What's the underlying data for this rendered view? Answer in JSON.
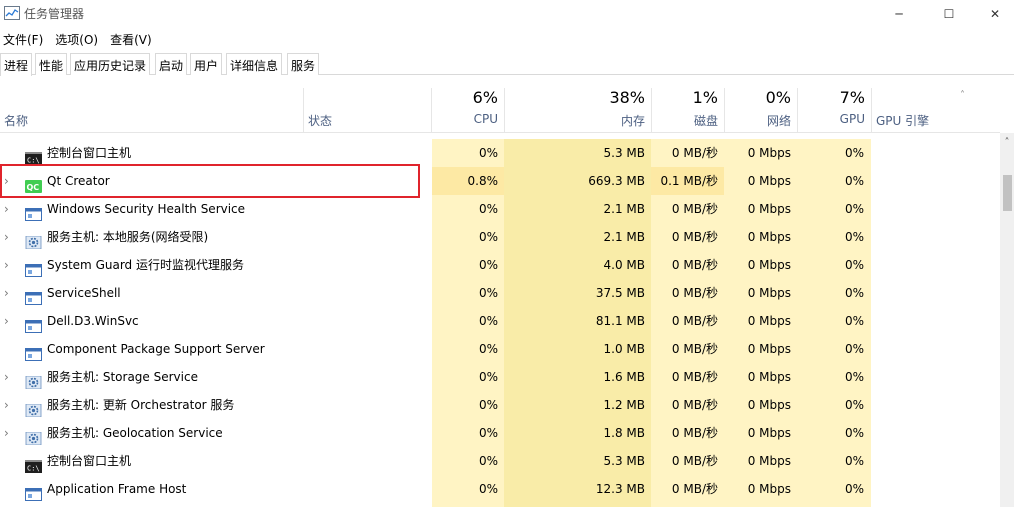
{
  "window": {
    "title": "任务管理器",
    "controls": {
      "minimize": "─",
      "maximize": "☐",
      "close": "✕"
    }
  },
  "menu": [
    "文件(F)",
    "选项(O)",
    "查看(V)"
  ],
  "tabs": [
    "进程",
    "性能",
    "应用历史记录",
    "启动",
    "用户",
    "详细信息",
    "服务"
  ],
  "active_tab": "进程",
  "columns": {
    "name": "名称",
    "status": "状态",
    "cpu": {
      "pct": "6%",
      "label": "CPU"
    },
    "memory": {
      "pct": "38%",
      "label": "内存"
    },
    "disk": {
      "pct": "1%",
      "label": "磁盘"
    },
    "network": {
      "pct": "0%",
      "label": "网络"
    },
    "gpu": {
      "pct": "7%",
      "label": "GPU"
    },
    "gpu_engine": "GPU 引擎"
  },
  "expander_glyph": "›",
  "sort_glyph": "˄",
  "scroll_up_glyph": "˄",
  "processes": [
    {
      "name": "控制台窗口主机",
      "icon": "console-icon",
      "expandable": false,
      "cpu": "0%",
      "memory": "5.3 MB",
      "disk": "0 MB/秒",
      "network": "0 Mbps",
      "gpu": "0%"
    },
    {
      "name": "Qt Creator",
      "icon": "qt-icon",
      "expandable": true,
      "cpu": "0.8%",
      "memory": "669.3 MB",
      "disk": "0.1 MB/秒",
      "network": "0 Mbps",
      "gpu": "0%",
      "highlight": true
    },
    {
      "name": "Windows Security Health Service",
      "icon": "window-icon",
      "expandable": true,
      "cpu": "0%",
      "memory": "2.1 MB",
      "disk": "0 MB/秒",
      "network": "0 Mbps",
      "gpu": "0%"
    },
    {
      "name": "服务主机: 本地服务(网络受限)",
      "icon": "gear-icon",
      "expandable": true,
      "cpu": "0%",
      "memory": "2.1 MB",
      "disk": "0 MB/秒",
      "network": "0 Mbps",
      "gpu": "0%"
    },
    {
      "name": "System Guard 运行时监视代理服务",
      "icon": "window-icon",
      "expandable": true,
      "cpu": "0%",
      "memory": "4.0 MB",
      "disk": "0 MB/秒",
      "network": "0 Mbps",
      "gpu": "0%"
    },
    {
      "name": "ServiceShell",
      "icon": "window-icon",
      "expandable": true,
      "cpu": "0%",
      "memory": "37.5 MB",
      "disk": "0 MB/秒",
      "network": "0 Mbps",
      "gpu": "0%"
    },
    {
      "name": "Dell.D3.WinSvc",
      "icon": "window-icon",
      "expandable": true,
      "cpu": "0%",
      "memory": "81.1 MB",
      "disk": "0 MB/秒",
      "network": "0 Mbps",
      "gpu": "0%"
    },
    {
      "name": "Component Package Support Server",
      "icon": "window-icon",
      "expandable": false,
      "cpu": "0%",
      "memory": "1.0 MB",
      "disk": "0 MB/秒",
      "network": "0 Mbps",
      "gpu": "0%"
    },
    {
      "name": "服务主机: Storage Service",
      "icon": "gear-icon",
      "expandable": true,
      "cpu": "0%",
      "memory": "1.6 MB",
      "disk": "0 MB/秒",
      "network": "0 Mbps",
      "gpu": "0%"
    },
    {
      "name": "服务主机: 更新 Orchestrator 服务",
      "icon": "gear-icon",
      "expandable": true,
      "cpu": "0%",
      "memory": "1.2 MB",
      "disk": "0 MB/秒",
      "network": "0 Mbps",
      "gpu": "0%"
    },
    {
      "name": "服务主机: Geolocation Service",
      "icon": "gear-icon",
      "expandable": true,
      "cpu": "0%",
      "memory": "1.8 MB",
      "disk": "0 MB/秒",
      "network": "0 Mbps",
      "gpu": "0%"
    },
    {
      "name": "控制台窗口主机",
      "icon": "console-icon",
      "expandable": false,
      "cpu": "0%",
      "memory": "5.3 MB",
      "disk": "0 MB/秒",
      "network": "0 Mbps",
      "gpu": "0%"
    },
    {
      "name": "Application Frame Host",
      "icon": "window-icon",
      "expandable": false,
      "cpu": "0%",
      "memory": "12.3 MB",
      "disk": "0 MB/秒",
      "network": "0 Mbps",
      "gpu": "0%"
    }
  ],
  "colors": {
    "cell_bg": "#fff4c4",
    "memory_bg": "#f9eca8",
    "highlight_bg": "#fde9a4",
    "header_label": "#4d6082",
    "selection_box": "#e0242c",
    "qt_green": "#41cd52"
  }
}
